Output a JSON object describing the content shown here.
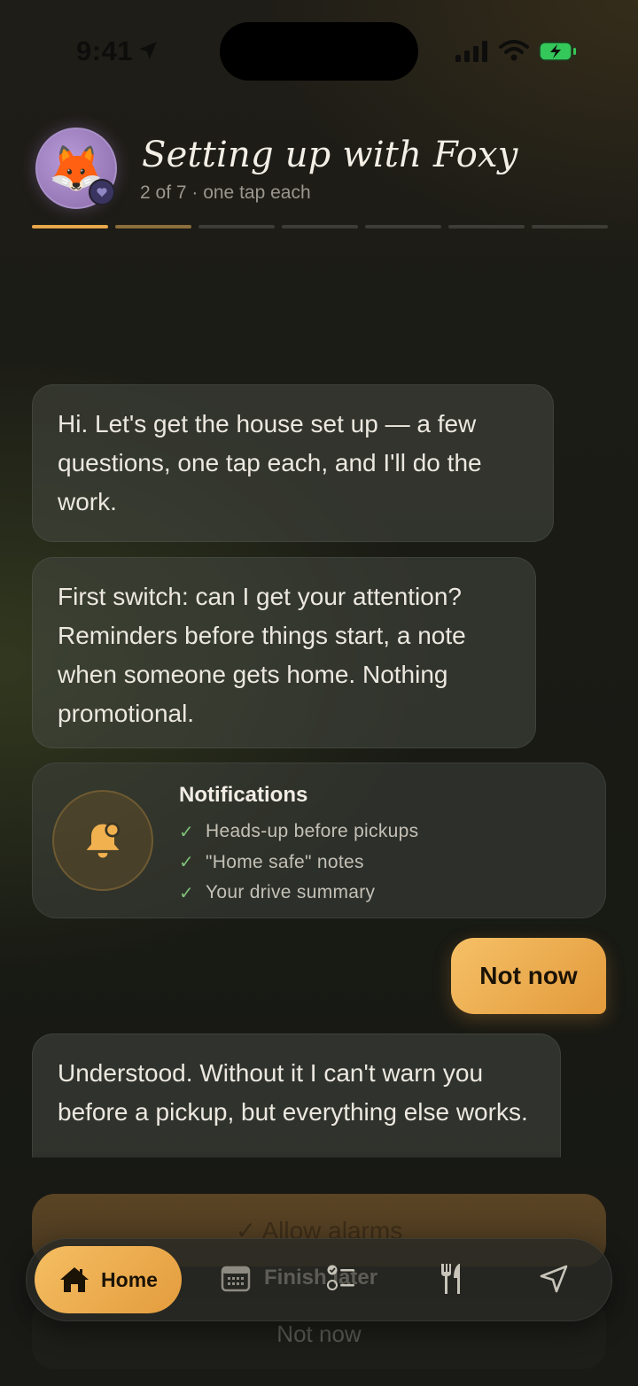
{
  "status_bar": {
    "time": "9:41"
  },
  "header": {
    "title": "Setting up with Foxy",
    "subtitle": "2 of 7 · one tap each",
    "avatar_emoji": "🦊",
    "progress": {
      "step": 2,
      "total": 7
    }
  },
  "messages": [
    {
      "from": "assistant",
      "text": "Hi. Let's get the house set up — a few questions, one tap each, and I'll do the work."
    },
    {
      "from": "assistant",
      "text": "First switch: can I get your attention? Reminders before things start, a note when someone gets home. Nothing promotional."
    },
    {
      "from": "user",
      "text": "Not now"
    },
    {
      "from": "assistant",
      "text": "Understood. Without it I can't warn you before a pickup, but everything else works."
    }
  ],
  "notification_card": {
    "title": "Notifications",
    "items": [
      "Heads-up before pickups",
      "\"Home safe\" notes",
      "Your drive summary"
    ],
    "icon": "bell-icon"
  },
  "actions": {
    "allow_label": "✓ Allow alarms",
    "not_now_label": "Not now",
    "finish_later_label": "Finish later"
  },
  "tabbar": {
    "home_label": "Home",
    "tabs": [
      "home-icon",
      "calendar-icon",
      "checklist-icon",
      "dining-icon",
      "navigation-icon"
    ]
  },
  "colors": {
    "accent": "#E8A64A",
    "check": "#7ec07a"
  }
}
